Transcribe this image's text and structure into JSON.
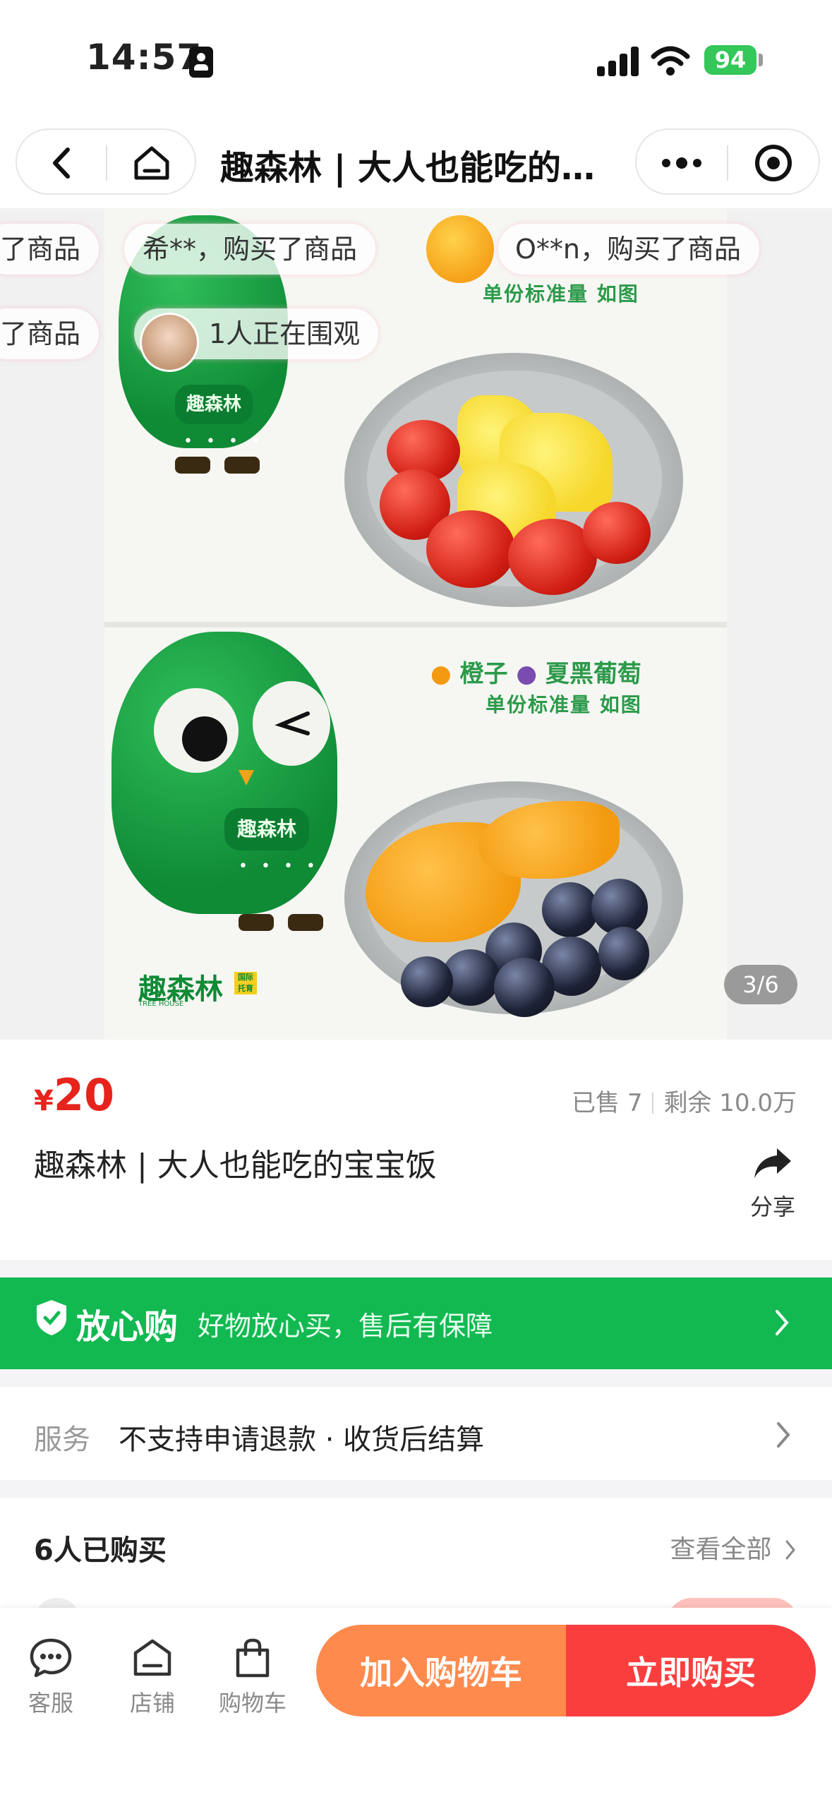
{
  "status_bar": {
    "time": "14:57",
    "battery": "94"
  },
  "nav": {
    "title": "趣森林 | 大人也能吃的宝宝饭",
    "back_icon": "chevron-left-icon",
    "home_icon": "home-icon",
    "more_icon": "more-dots-icon",
    "close_icon": "target-icon"
  },
  "gallery": {
    "counter": "3/6",
    "top_caption": "单份标准量 如图",
    "bottom_caption_fruit1": "橙子",
    "bottom_caption_fruit2": "夏黑葡萄",
    "bottom_caption_line2": "单份标准量 如图",
    "owl_plate": "趣森林",
    "brand": "趣森林",
    "brand_tag": "国际托育",
    "brand_sub": "TREE HOUSE",
    "bubbles": [
      "了商品",
      "希**，购买了商品",
      "O**n，购买了商品",
      "了商品",
      "1人正在围观"
    ]
  },
  "product": {
    "currency": "¥",
    "price": "20",
    "sold": "已售 7",
    "remaining": "剩余 10.0万",
    "name": "趣森林 | 大人也能吃的宝宝饭",
    "share_label": "分享"
  },
  "assurance": {
    "title": "放心购",
    "text": "好物放心买，售后有保障"
  },
  "service": {
    "label": "服务",
    "value": "不支持申请退款 · 收货后结算"
  },
  "buyers": {
    "title": "6人已购买",
    "link": "查看全部"
  },
  "bottom_bar": {
    "tabs": [
      {
        "label": "客服",
        "icon": "chat-icon"
      },
      {
        "label": "店铺",
        "icon": "store-icon"
      },
      {
        "label": "购物车",
        "icon": "bag-icon"
      }
    ],
    "add_to_cart": "加入购物车",
    "buy_now": "立即购买"
  },
  "colors": {
    "price_red": "#e6241c",
    "assurance_green": "#12b951",
    "cart_orange": "#ff8a4d",
    "buy_red": "#fa3e3e"
  }
}
